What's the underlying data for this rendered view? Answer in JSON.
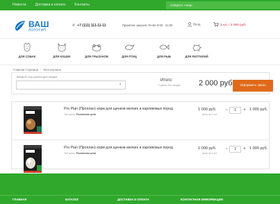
{
  "topbar": {
    "nav": [
      "Новости",
      "Доставка и оплата",
      "Контакты"
    ],
    "search_placeholder": "Найдите товар"
  },
  "header": {
    "logo_big": "ВАШ",
    "logo_small": "ЛОГОТИП",
    "phone": "+7 (111) 111-11-11",
    "hours": "Принятие заказов: Пн-Вс 9:00 - 21:00",
    "login": "Вход",
    "cart": "2 шт. / 2 000 руб."
  },
  "categories": [
    {
      "label": "ДЛЯ СОБАК",
      "icon": "dog-icon"
    },
    {
      "label": "ДЛЯ КОШЕК",
      "icon": "cat-icon"
    },
    {
      "label": "ДЛЯ ГРЫЗУНОВ",
      "icon": "rodent-icon"
    },
    {
      "label": "ДЛЯ ПТИЦ",
      "icon": "bird-icon"
    },
    {
      "label": "ДЛЯ РЫБ",
      "icon": "fish-icon"
    },
    {
      "label": "ДЛЯ РЕПТИЛИЙ",
      "icon": "reptile-icon"
    }
  ],
  "breadcrumb": [
    "Главная страница",
    "Моя корзина"
  ],
  "order": {
    "coupon_label": "Введите код купона для скидки:",
    "coupon_button": "›",
    "total_label": "Итого:",
    "total_sub": "Сумма без скидки",
    "total_value": "2 000 руб.",
    "checkout_label": "Оформить заказ"
  },
  "items": [
    {
      "name": "Pro Plan (Проплан) корм для щенков мелких и карликовых пород",
      "price_type_label": "Тип цены:",
      "price_type_value": "Розничная цена",
      "unit_price": "1 000 руб.",
      "unit_price_sub": "цена за 1 шт",
      "qty": "1",
      "minus": "−",
      "plus": "+",
      "total": "1 000 руб."
    },
    {
      "name": "Pro Plan (Проплан) корм для щенков мелких и карликовых пород",
      "price_type_label": "Тип цены:",
      "price_type_value": "Розничная цена",
      "unit_price": "1 000 руб.",
      "unit_price_sub": "цена за 1 шт",
      "qty": "1",
      "minus": "−",
      "plus": "+",
      "total": "1 000 руб."
    }
  ],
  "footer": {
    "menu": [
      "ГЛАВНАЯ",
      "КАТАЛОГ",
      "ДОСТАВКА И ОПЛАТА",
      "КОНТАКТНАЯ ИНФОРМАЦИЯ"
    ]
  },
  "colors": {
    "brand_green": "#2fa82c",
    "accent_orange": "#e06a1a",
    "logo_blue": "#1677c4",
    "cart_red": "#d3283d"
  }
}
